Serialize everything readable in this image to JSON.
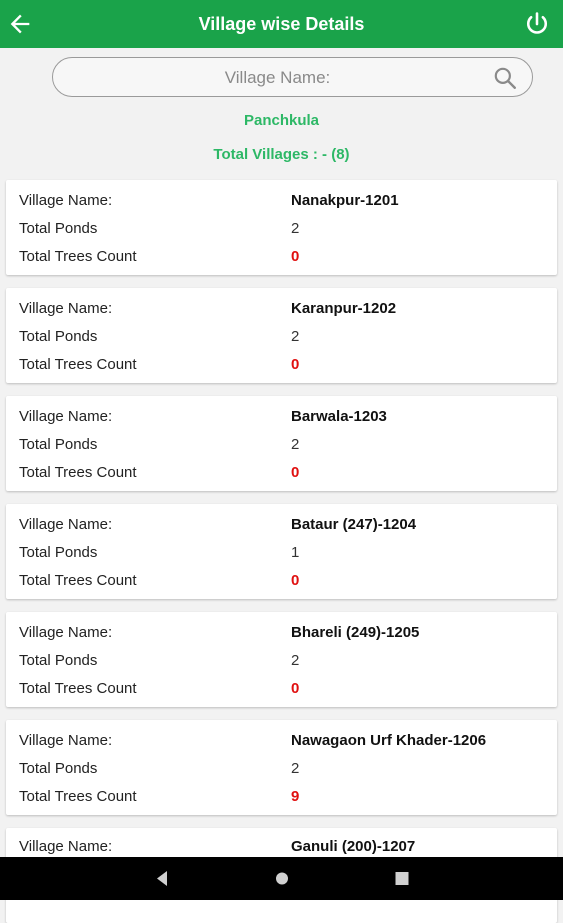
{
  "header": {
    "title": "Village wise Details",
    "back_icon": "arrow-left-icon",
    "power_icon": "power-icon",
    "bg_color": "#1aa34a"
  },
  "search": {
    "placeholder": "Village Name:",
    "value": "",
    "icon": "search-icon"
  },
  "district": "Panchkula",
  "total_villages": "Total Villages : - (8)",
  "labels": {
    "village_name": "Village Name:",
    "total_ponds": "Total Ponds",
    "total_trees": "Total Trees Count"
  },
  "villages": [
    {
      "name": "Nanakpur-1201",
      "ponds": "2",
      "trees": "0"
    },
    {
      "name": "Karanpur-1202",
      "ponds": "2",
      "trees": "0"
    },
    {
      "name": "Barwala-1203",
      "ponds": "2",
      "trees": "0"
    },
    {
      "name": "Bataur (247)-1204",
      "ponds": "1",
      "trees": "0"
    },
    {
      "name": "Bhareli (249)-1205",
      "ponds": "2",
      "trees": "0"
    },
    {
      "name": "Nawagaon Urf Khader-1206",
      "ponds": "2",
      "trees": "9"
    },
    {
      "name": "Ganuli (200)-1207",
      "ponds": "",
      "trees": ""
    }
  ],
  "nav": {
    "back": "nav-back-icon",
    "home": "nav-home-icon",
    "recents": "nav-recents-icon"
  },
  "colors": {
    "accent_green": "#2db866",
    "trees_count": "#e01010"
  }
}
